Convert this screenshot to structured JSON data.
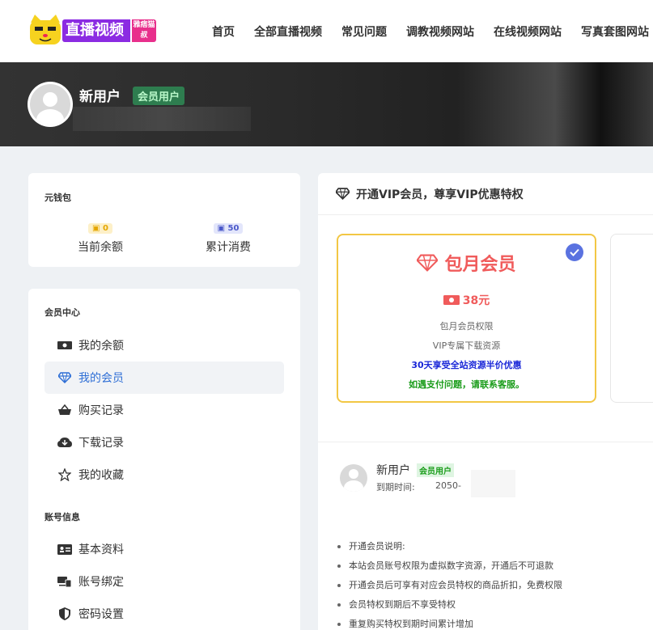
{
  "header": {
    "logo_text": "直播视频",
    "logo_tag": "雅痞猫叔",
    "nav": [
      "首页",
      "全部直播视频",
      "常见问题",
      "调教视频网站",
      "在线视频网站",
      "写真套图网站"
    ]
  },
  "banner": {
    "username": "新用户",
    "badge": "会员用户"
  },
  "wallet": {
    "title": "元钱包",
    "balance_value": "0",
    "balance_label": "当前余额",
    "spent_value": "50",
    "spent_label": "累计消费"
  },
  "member_center": {
    "title": "会员中心",
    "items": [
      "我的余额",
      "我的会员",
      "购买记录",
      "下载记录",
      "我的收藏"
    ],
    "active_index": 1
  },
  "account": {
    "title": "账号信息",
    "items": [
      "基本资料",
      "账号绑定",
      "密码设置"
    ]
  },
  "main": {
    "heading": "开通VIP会员，尊享VIP优惠特权",
    "plan": {
      "name": "包月会员",
      "price": "38元",
      "line1": "包月会员权限",
      "line2": "VIP专属下载资源",
      "line3": "30天享受全站资源半价优惠",
      "line4": "如遇支付问题，请联系客服。"
    },
    "user": {
      "name": "新用户",
      "badge": "会员用户",
      "expire_label": "到期时间:",
      "expire_value": "2050-"
    },
    "notes": [
      "开通会员说明:",
      "本站会员账号权限为虚拟数字资源，开通后不可退款",
      "开通会员后可享有对应会员特权的商品折扣，免费权限",
      "会员特权到期后不享受特权",
      "重复购买特权到期时间累计增加"
    ]
  },
  "colors": {
    "accent_blue": "#2f6fd6",
    "vip_red": "#f05b5b",
    "plan_border": "#f2c744",
    "check_blue": "#5a72e0"
  }
}
